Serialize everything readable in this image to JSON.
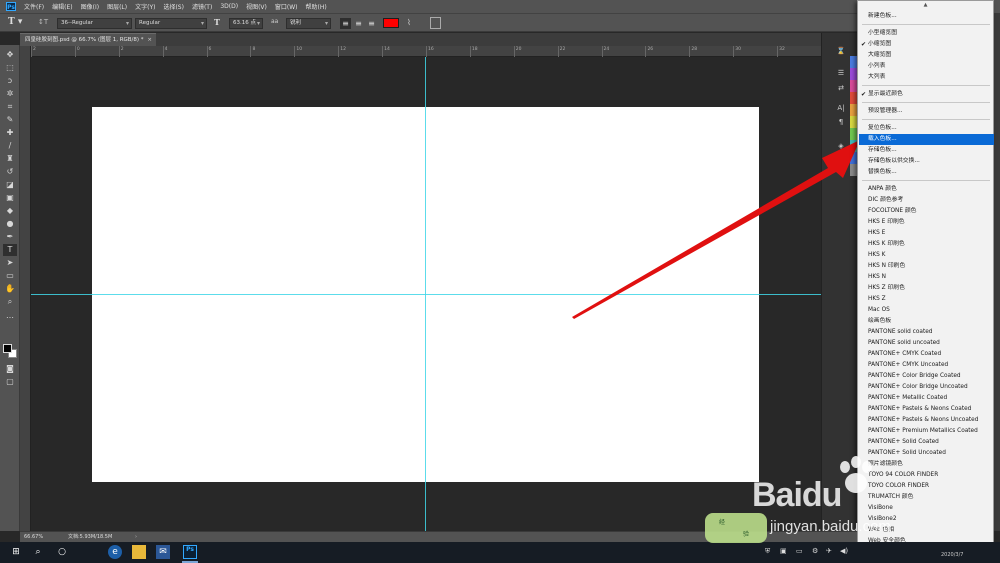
{
  "app": {
    "name": "Photoshop",
    "logo_text": "Ps"
  },
  "menubar": {
    "items": [
      "文件(F)",
      "编辑(E)",
      "图像(I)",
      "图层(L)",
      "文字(Y)",
      "选择(S)",
      "滤镜(T)",
      "3D(D)",
      "视图(V)",
      "窗口(W)",
      "帮助(H)"
    ]
  },
  "options_bar": {
    "font_family": "36--Regular",
    "font_style": "Regular",
    "font_size": "63.16 点",
    "anti_alias": "锐利",
    "text_color": "#ff0000"
  },
  "document": {
    "tab_title": "四皇硅胶刻图.psd @ 66.7% (图层 1, RGB/8) *",
    "zoom": "66.67%",
    "doc_info": "文档:5.93M/18.5M",
    "ruler_labels": [
      "2",
      "0",
      "2",
      "4",
      "6",
      "8",
      "10",
      "12",
      "14",
      "16",
      "18",
      "20",
      "22",
      "24",
      "26",
      "28",
      "30",
      "32"
    ]
  },
  "flyout_menu": {
    "items": [
      {
        "label": "新建色板...",
        "kind": "item"
      },
      {
        "label": "小型缩览图",
        "kind": "item"
      },
      {
        "label": "小缩览图",
        "kind": "item",
        "checked": true
      },
      {
        "label": "大缩览图",
        "kind": "item"
      },
      {
        "label": "小列表",
        "kind": "item"
      },
      {
        "label": "大列表",
        "kind": "item"
      },
      {
        "label": "显示最近颜色",
        "kind": "item",
        "checked": true
      },
      {
        "label": "预设管理器...",
        "kind": "item"
      },
      {
        "label": "复位色板...",
        "kind": "item"
      },
      {
        "label": "载入色板...",
        "kind": "item",
        "highlighted": true
      },
      {
        "label": "存储色板...",
        "kind": "item"
      },
      {
        "label": "存储色板以供交换...",
        "kind": "item"
      },
      {
        "label": "替换色板...",
        "kind": "item"
      },
      {
        "label": "ANPA 颜色",
        "kind": "item"
      },
      {
        "label": "DIC 颜色参考",
        "kind": "item"
      },
      {
        "label": "FOCOLTONE 颜色",
        "kind": "item"
      },
      {
        "label": "HKS E 印刷色",
        "kind": "item"
      },
      {
        "label": "HKS E",
        "kind": "item"
      },
      {
        "label": "HKS K 印刷色",
        "kind": "item"
      },
      {
        "label": "HKS K",
        "kind": "item"
      },
      {
        "label": "HKS N 印刷色",
        "kind": "item"
      },
      {
        "label": "HKS N",
        "kind": "item"
      },
      {
        "label": "HKS Z 印刷色",
        "kind": "item"
      },
      {
        "label": "HKS Z",
        "kind": "item"
      },
      {
        "label": "Mac OS",
        "kind": "item"
      },
      {
        "label": "绘画色板",
        "kind": "item"
      },
      {
        "label": "PANTONE solid coated",
        "kind": "item"
      },
      {
        "label": "PANTONE solid uncoated",
        "kind": "item"
      },
      {
        "label": "PANTONE+ CMYK Coated",
        "kind": "item"
      },
      {
        "label": "PANTONE+ CMYK Uncoated",
        "kind": "item"
      },
      {
        "label": "PANTONE+ Color Bridge Coated",
        "kind": "item"
      },
      {
        "label": "PANTONE+ Color Bridge Uncoated",
        "kind": "item"
      },
      {
        "label": "PANTONE+ Metallic Coated",
        "kind": "item"
      },
      {
        "label": "PANTONE+ Pastels & Neons Coated",
        "kind": "item"
      },
      {
        "label": "PANTONE+ Pastels & Neons Uncoated",
        "kind": "item"
      },
      {
        "label": "PANTONE+ Premium Metallics Coated",
        "kind": "item"
      },
      {
        "label": "PANTONE+ Solid Coated",
        "kind": "item"
      },
      {
        "label": "PANTONE+ Solid Uncoated",
        "kind": "item"
      },
      {
        "label": "照片滤镜颜色",
        "kind": "item"
      },
      {
        "label": "TOYO 94 COLOR FINDER",
        "kind": "item"
      },
      {
        "label": "TOYO COLOR FINDER",
        "kind": "item"
      },
      {
        "label": "TRUMATCH 颜色",
        "kind": "item"
      },
      {
        "label": "VisiBone",
        "kind": "item"
      },
      {
        "label": "VisiBone2",
        "kind": "item"
      },
      {
        "label": "Web 色相",
        "kind": "item"
      },
      {
        "label": "Web 安全颜色",
        "kind": "item"
      }
    ]
  },
  "statusbar": {
    "arrow": "›"
  },
  "taskbar": {
    "date": "2020/3/7"
  },
  "watermark": {
    "brand": "Baidu",
    "sub": "jingyan.baidu.com",
    "badge_left": "经",
    "badge_right": "验"
  },
  "colors": {
    "accent_highlight": "#0a6ad6",
    "guide": "#3fd6e8",
    "annotation_arrow": "#e01010",
    "swatches": [
      "#4a7be0",
      "#9a4ad8",
      "#d84a9a",
      "#e04a3a",
      "#e8a040",
      "#d8d840",
      "#70c850",
      "#40b8b8",
      "#4070d8",
      "#8a8a8a"
    ]
  }
}
